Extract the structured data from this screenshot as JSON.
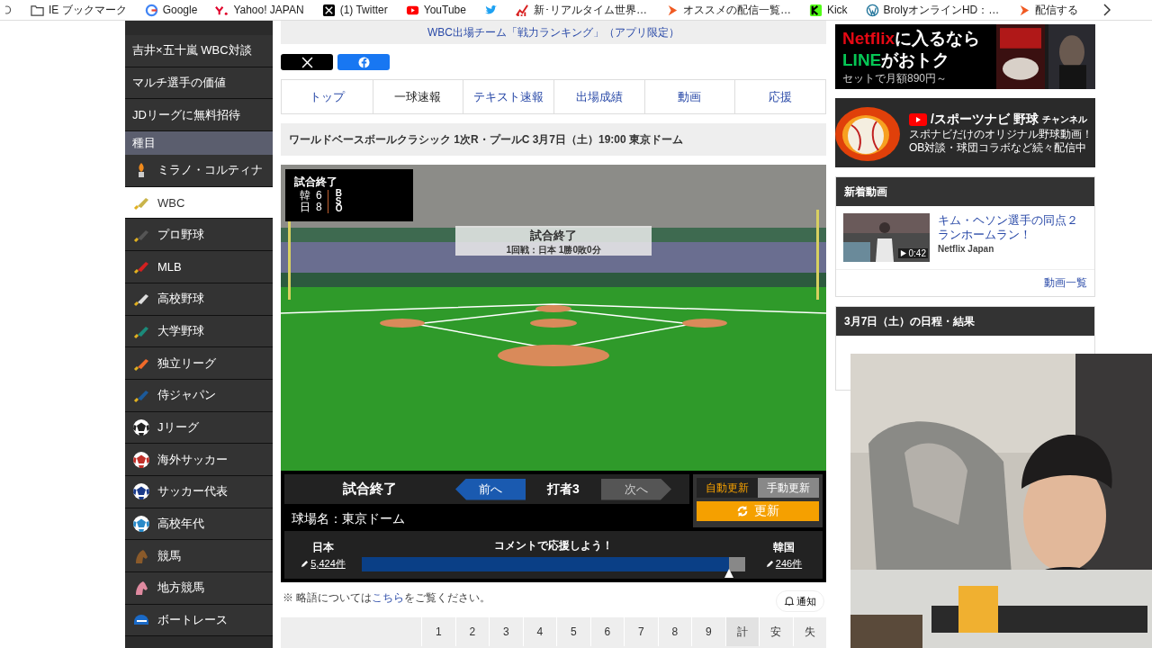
{
  "bookmarks": [
    {
      "kind": "folder",
      "label": "IE ブックマーク"
    },
    {
      "kind": "google",
      "label": "Google"
    },
    {
      "kind": "yahoo",
      "label": "Yahoo! JAPAN"
    },
    {
      "kind": "x",
      "label": "(1) Twitter"
    },
    {
      "kind": "youtube",
      "label": "YouTube"
    },
    {
      "kind": "bird"
    },
    {
      "kind": "chart",
      "label": "新･リアルタイム世界…"
    },
    {
      "kind": "flame",
      "label": "オススメの配信一覧…"
    },
    {
      "kind": "kick",
      "label": "Kick"
    },
    {
      "kind": "wordpress",
      "label": "BrolyオンラインHD：…"
    },
    {
      "kind": "flame",
      "label": "配信する"
    }
  ],
  "sidebar": {
    "features": [
      "吉井×五十嵐 WBC対談",
      "マルチ選手の価値",
      "JDリーグに無料招待"
    ],
    "section_title": "種目",
    "sports": [
      {
        "label": "ミラノ・コルティナ",
        "kind": "torch",
        "color": "#f08a1c",
        "selected": false
      },
      {
        "label": "WBC",
        "kind": "bat",
        "color": "#c9b44a",
        "selected": true
      },
      {
        "label": "プロ野球",
        "kind": "bat",
        "color": "#555555",
        "selected": false
      },
      {
        "label": "MLB",
        "kind": "bat",
        "color": "#d42020",
        "selected": false
      },
      {
        "label": "高校野球",
        "kind": "bat",
        "color": "#dddddd",
        "selected": false
      },
      {
        "label": "大学野球",
        "kind": "bat",
        "color": "#1b8a7a",
        "selected": false
      },
      {
        "label": "独立リーグ",
        "kind": "bat",
        "color": "#f06a2a",
        "selected": false
      },
      {
        "label": "侍ジャパン",
        "kind": "bat",
        "color": "#1c5a9a",
        "selected": false
      },
      {
        "label": "Jリーグ",
        "kind": "ball",
        "color": "#222222",
        "selected": false
      },
      {
        "label": "海外サッカー",
        "kind": "ball",
        "color": "#c0302a",
        "selected": false
      },
      {
        "label": "サッカー代表",
        "kind": "ball",
        "color": "#1a3a8a",
        "selected": false
      },
      {
        "label": "高校年代",
        "kind": "ball",
        "color": "#2a8ac8",
        "selected": false
      },
      {
        "label": "競馬",
        "kind": "horse",
        "color": "#8a5a2a",
        "selected": false
      },
      {
        "label": "地方競馬",
        "kind": "horse",
        "color": "#e08aa0",
        "selected": false
      },
      {
        "label": "ボートレース",
        "kind": "boat",
        "color": "#1a6ac8",
        "selected": false
      }
    ]
  },
  "main": {
    "promo_link": "WBC出場チーム「戦力ランキング」（アプリ限定）",
    "tabs": [
      {
        "label": "トップ",
        "selected": false
      },
      {
        "label": "一球速報",
        "selected": true
      },
      {
        "label": "テキスト速報",
        "selected": false
      },
      {
        "label": "出場成績",
        "selected": false
      },
      {
        "label": "動画",
        "selected": false
      },
      {
        "label": "応援",
        "selected": false
      }
    ],
    "game_title": "ワールドベースボールクラシック 1次R・プールC 3月7日（土）19:00 東京ドーム",
    "scoreboard": {
      "status": "試合終了",
      "teams": [
        {
          "name": "韓",
          "score": "6"
        },
        {
          "name": "日",
          "score": "8"
        }
      ],
      "counts": [
        "B",
        "S",
        "O"
      ]
    },
    "field_label": {
      "title": "試合終了",
      "detail": "1回戦：日本 1勝0敗0分"
    },
    "panel": {
      "status": "試合終了",
      "prev": "前へ",
      "batter": "打者3",
      "next": "次へ",
      "stadium": "球場名：東京ドーム",
      "modes": [
        {
          "label": "自動更新",
          "selected": true
        },
        {
          "label": "手動更新",
          "selected": false
        }
      ],
      "refresh": "更新"
    },
    "cheer": {
      "prompt": "コメントで応援しよう！",
      "home": {
        "name": "日本",
        "count": "5,424件"
      },
      "away": {
        "name": "韓国",
        "count": "246件"
      },
      "level": 0.957
    },
    "note": {
      "before": "※ 略語については",
      "link": "こちら",
      "after": "をご覧ください。"
    },
    "notify": "通知",
    "innings": [
      "1",
      "2",
      "3",
      "4",
      "5",
      "6",
      "7",
      "8",
      "9",
      "計",
      "安",
      "失"
    ]
  },
  "right": {
    "ad1": {
      "brand": "Netflix",
      "brand_rest": "に入るなら",
      "line": "LINE",
      "line_rest": "がおトク",
      "price": "セットで月額890円～"
    },
    "ad2": {
      "channel": "/スポーツナビ 野球",
      "channel_suffix": "チャンネル",
      "lines": [
        "スポナビだけのオリジナル野球動画！",
        "OB対談・球団コラボなど続々配信中"
      ]
    },
    "videos_title": "新着動画",
    "video": {
      "duration": "0:42",
      "title": "キム・ヘソン選手の同点２ランホームラン！",
      "source": "Netflix Japan"
    },
    "more": "動画一覧",
    "schedule_title": "3月7日（土）の日程・結果"
  }
}
